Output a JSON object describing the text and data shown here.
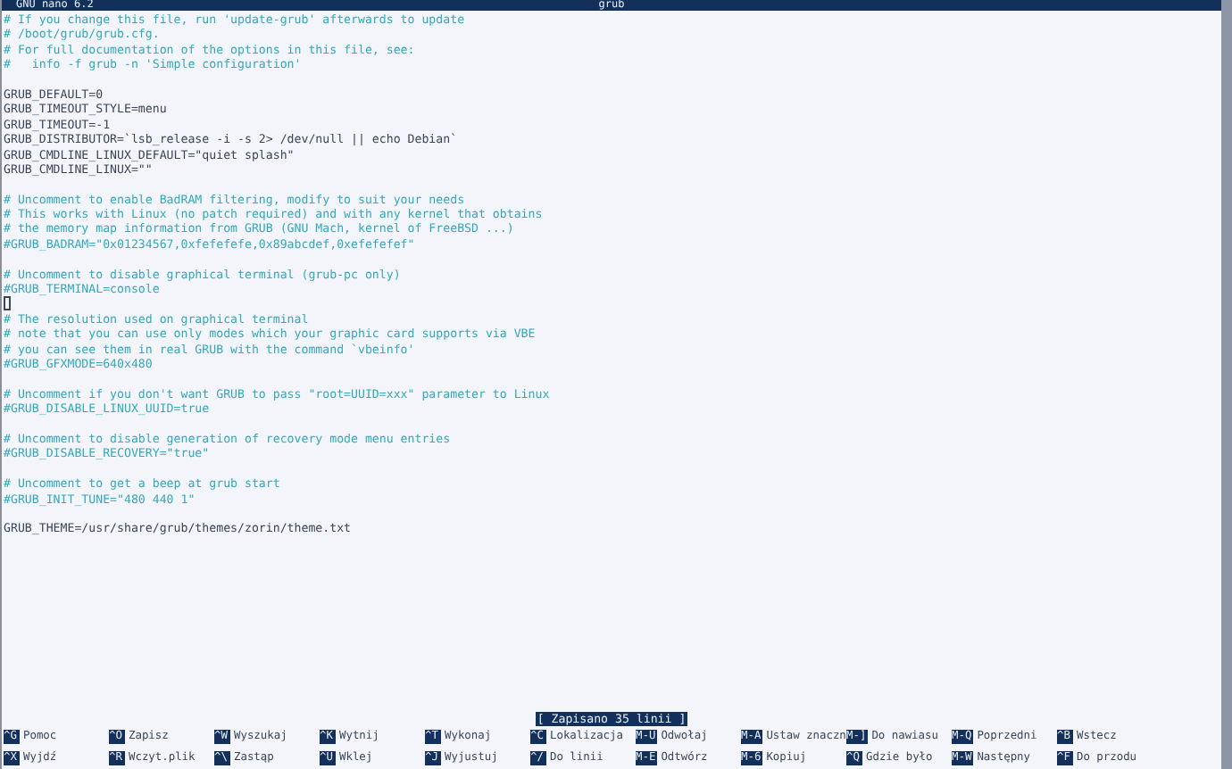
{
  "title_bar": {
    "app": "GNU nano 6.2",
    "file": "grub"
  },
  "editor": {
    "lines": [
      {
        "kind": "comment",
        "text": "# If you change this file, run 'update-grub' afterwards to update"
      },
      {
        "kind": "comment",
        "text": "# /boot/grub/grub.cfg."
      },
      {
        "kind": "comment",
        "text": "# For full documentation of the options in this file, see:"
      },
      {
        "kind": "comment",
        "text": "#   info -f grub -n 'Simple configuration'"
      },
      {
        "kind": "blank"
      },
      {
        "kind": "setting",
        "text": "GRUB_DEFAULT=0"
      },
      {
        "kind": "setting",
        "text": "GRUB_TIMEOUT_STYLE=menu"
      },
      {
        "kind": "setting",
        "text": "GRUB_TIMEOUT=-1"
      },
      {
        "kind": "setting",
        "text": "GRUB_DISTRIBUTOR=`lsb_release -i -s 2> /dev/null || echo Debian`"
      },
      {
        "kind": "setting",
        "text": "GRUB_CMDLINE_LINUX_DEFAULT=\"quiet splash\""
      },
      {
        "kind": "setting",
        "text": "GRUB_CMDLINE_LINUX=\"\""
      },
      {
        "kind": "blank"
      },
      {
        "kind": "comment",
        "text": "# Uncomment to enable BadRAM filtering, modify to suit your needs"
      },
      {
        "kind": "comment",
        "text": "# This works with Linux (no patch required) and with any kernel that obtains"
      },
      {
        "kind": "comment",
        "text": "# the memory map information from GRUB (GNU Mach, kernel of FreeBSD ...)"
      },
      {
        "kind": "comment",
        "text": "#GRUB_BADRAM=\"0x01234567,0xfefefefe,0x89abcdef,0xefefefef\""
      },
      {
        "kind": "blank"
      },
      {
        "kind": "comment",
        "text": "# Uncomment to disable graphical terminal (grub-pc only)"
      },
      {
        "kind": "comment",
        "text": "#GRUB_TERMINAL=console"
      },
      {
        "kind": "blank",
        "cursor": true
      },
      {
        "kind": "comment",
        "text": "# The resolution used on graphical terminal"
      },
      {
        "kind": "comment",
        "text": "# note that you can use only modes which your graphic card supports via VBE"
      },
      {
        "kind": "comment",
        "text": "# you can see them in real GRUB with the command `vbeinfo'"
      },
      {
        "kind": "comment",
        "text": "#GRUB_GFXMODE=640x480"
      },
      {
        "kind": "blank"
      },
      {
        "kind": "comment",
        "text": "# Uncomment if you don't want GRUB to pass \"root=UUID=xxx\" parameter to Linux"
      },
      {
        "kind": "comment",
        "text": "#GRUB_DISABLE_LINUX_UUID=true"
      },
      {
        "kind": "blank"
      },
      {
        "kind": "comment",
        "text": "# Uncomment to disable generation of recovery mode menu entries"
      },
      {
        "kind": "comment",
        "text": "#GRUB_DISABLE_RECOVERY=\"true\""
      },
      {
        "kind": "blank"
      },
      {
        "kind": "comment",
        "text": "# Uncomment to get a beep at grub start"
      },
      {
        "kind": "comment",
        "text": "#GRUB_INIT_TUNE=\"480 440 1\""
      },
      {
        "kind": "blank"
      },
      {
        "kind": "setting",
        "text": "GRUB_THEME=/usr/share/grub/themes/zorin/theme.txt"
      }
    ]
  },
  "status_message": "[ Zapisano 35 linii ]",
  "shortcuts": [
    {
      "key": "^G",
      "label": "Pomoc"
    },
    {
      "key": "^O",
      "label": "Zapisz"
    },
    {
      "key": "^W",
      "label": "Wyszukaj"
    },
    {
      "key": "^K",
      "label": "Wytnij"
    },
    {
      "key": "^T",
      "label": "Wykonaj"
    },
    {
      "key": "^C",
      "label": "Lokalizacja"
    },
    {
      "key": "M-U",
      "label": "Odwołaj"
    },
    {
      "key": "M-A",
      "label": "Ustaw znaczn"
    },
    {
      "key": "M-]",
      "label": "Do nawiasu"
    },
    {
      "key": "M-Q",
      "label": "Poprzedni"
    },
    {
      "key": "^B",
      "label": "Wstecz"
    },
    {
      "key": "^X",
      "label": "Wyjdź"
    },
    {
      "key": "^R",
      "label": "Wczyt.plik"
    },
    {
      "key": "^\\",
      "label": "Zastąp"
    },
    {
      "key": "^U",
      "label": "Wklej"
    },
    {
      "key": "^J",
      "label": "Wyjustuj"
    },
    {
      "key": "^/",
      "label": "Do linii"
    },
    {
      "key": "M-E",
      "label": "Odtwórz"
    },
    {
      "key": "M-6",
      "label": "Kopiuj"
    },
    {
      "key": "^Q",
      "label": "Gdzie było"
    },
    {
      "key": "M-W",
      "label": "Następny"
    },
    {
      "key": "^F",
      "label": "Do przodu"
    }
  ]
}
